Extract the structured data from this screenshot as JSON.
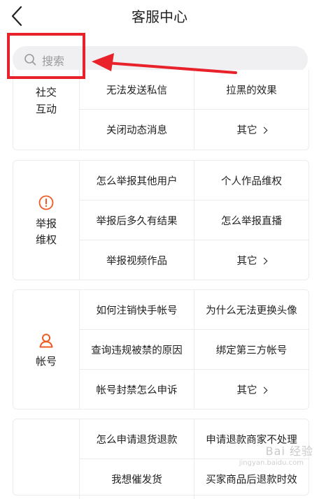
{
  "header": {
    "title": "客服中心",
    "back_icon": "chevron-left-icon"
  },
  "search": {
    "placeholder": "搜索",
    "icon": "search-icon"
  },
  "annotation": {
    "color": "#e8212b"
  },
  "sections": [
    {
      "category": "社交互动",
      "category_lines": [
        "社交",
        "互动"
      ],
      "rows": [
        [
          "无法发送私信",
          "拉黑的效果"
        ],
        [
          "关闭动态消息",
          "其它"
        ]
      ]
    },
    {
      "category": "举报维权",
      "category_lines": [
        "举报",
        "维权"
      ],
      "icon": "warning-circle-icon",
      "rows": [
        [
          "怎么举报其他用户",
          "个人作品维权"
        ],
        [
          "举报后多久有结果",
          "怎么举报直播"
        ],
        [
          "举报视频作品",
          "其它"
        ]
      ]
    },
    {
      "category": "帐号",
      "category_lines": [
        "帐号"
      ],
      "icon": "user-icon",
      "rows": [
        [
          "如何注销快手帐号",
          "为什么无法更换头像"
        ],
        [
          "查询违规被禁的原因",
          "绑定第三方帐号"
        ],
        [
          "帐号封禁怎么申诉",
          "其它"
        ]
      ]
    },
    {
      "rows": [
        [
          "怎么申请退货退款",
          "申请退款商家不处理"
        ],
        [
          "我想催发货",
          "买家商品后退款时效"
        ]
      ]
    }
  ],
  "accent_color": "#f05a22",
  "watermark": {
    "text": "Bai 经验",
    "sub": "jingyan.baidu.com"
  }
}
